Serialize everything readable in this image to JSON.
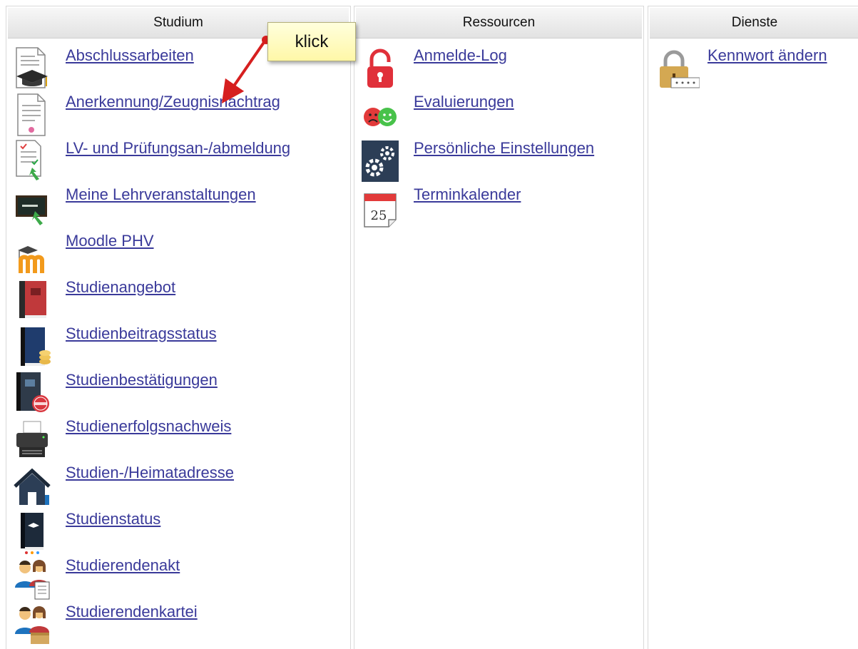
{
  "columns": {
    "studium": {
      "header": "Studium",
      "items": [
        {
          "label": "Abschlussarbeiten",
          "icon": "graduation-document-icon"
        },
        {
          "label": "Anerkennung/Zeugnisnachtrag",
          "icon": "certificate-document-icon"
        },
        {
          "label": "LV- und Prüfungsan-/abmeldung",
          "icon": "checklist-document-icon"
        },
        {
          "label": "Meine Lehrveranstaltungen",
          "icon": "blackboard-icon"
        },
        {
          "label": "Moodle PHV",
          "icon": "moodle-icon"
        },
        {
          "label": "Studienangebot",
          "icon": "red-book-icon"
        },
        {
          "label": "Studienbeitragsstatus",
          "icon": "book-coins-icon"
        },
        {
          "label": "Studienbestätigungen",
          "icon": "book-stamp-icon"
        },
        {
          "label": "Studienerfolgsnachweis",
          "icon": "printer-icon"
        },
        {
          "label": "Studien-/Heimatadresse",
          "icon": "house-icon"
        },
        {
          "label": "Studienstatus",
          "icon": "book-status-icon"
        },
        {
          "label": "Studierendenakt",
          "icon": "students-document-icon"
        },
        {
          "label": "Studierendenkartei",
          "icon": "students-cardfile-icon"
        }
      ]
    },
    "ressourcen": {
      "header": "Ressourcen",
      "items": [
        {
          "label": "Anmelde-Log",
          "icon": "padlock-icon"
        },
        {
          "label": "Evaluierungen",
          "icon": "smiley-faces-icon"
        },
        {
          "label": "Persönliche Einstellungen",
          "icon": "gears-icon"
        },
        {
          "label": "Terminkalender",
          "icon": "calendar-icon",
          "day": "25"
        }
      ]
    },
    "dienste": {
      "header": "Dienste",
      "items": [
        {
          "label": "Kennwort ändern",
          "icon": "password-lock-icon"
        }
      ]
    }
  },
  "callout": {
    "text": "klick"
  },
  "colors": {
    "link": "#3a3a9a",
    "arrow": "#d61f1f",
    "callout": "#fff7a8"
  }
}
